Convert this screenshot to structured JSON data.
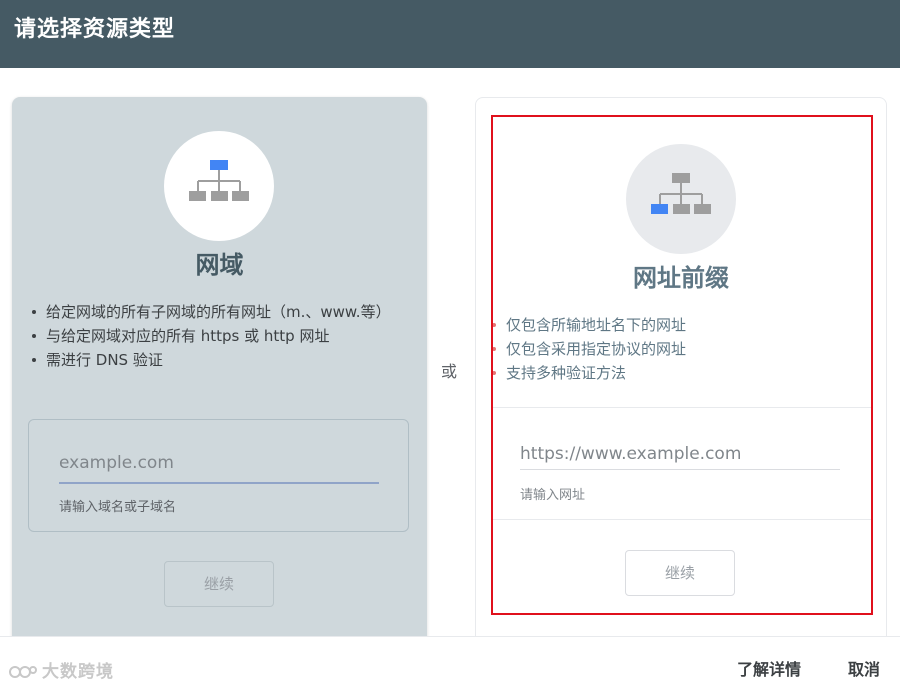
{
  "header": {
    "title": "请选择资源类型"
  },
  "domain_card": {
    "icon": "sitemap-icon",
    "title": "网域",
    "bullets": [
      "给定网域的所有子网域的所有网址（m.、www.等）",
      "与给定网域对应的所有 https 或 http 网址",
      "需进行 DNS 验证"
    ],
    "input_placeholder": "example.com",
    "input_hint": "请输入域名或子域名",
    "continue_label": "继续"
  },
  "separator": {
    "label": "或"
  },
  "url_prefix_card": {
    "icon": "sitemap-icon",
    "title": "网址前缀",
    "bullets": [
      "仅包含所输地址名下的网址",
      "仅包含采用指定协议的网址",
      "支持多种验证方法"
    ],
    "input_placeholder": "https://www.example.com",
    "input_hint": "请输入网址",
    "continue_label": "继续",
    "highlight_color": "#e0101c"
  },
  "footer": {
    "watermark": "大数跨境",
    "learn_more_label": "了解详情",
    "cancel_label": "取消"
  },
  "colors": {
    "header_bg": "#455a64",
    "domain_card_bg": "#cfd8dc",
    "accent_blue": "#4285f4"
  }
}
